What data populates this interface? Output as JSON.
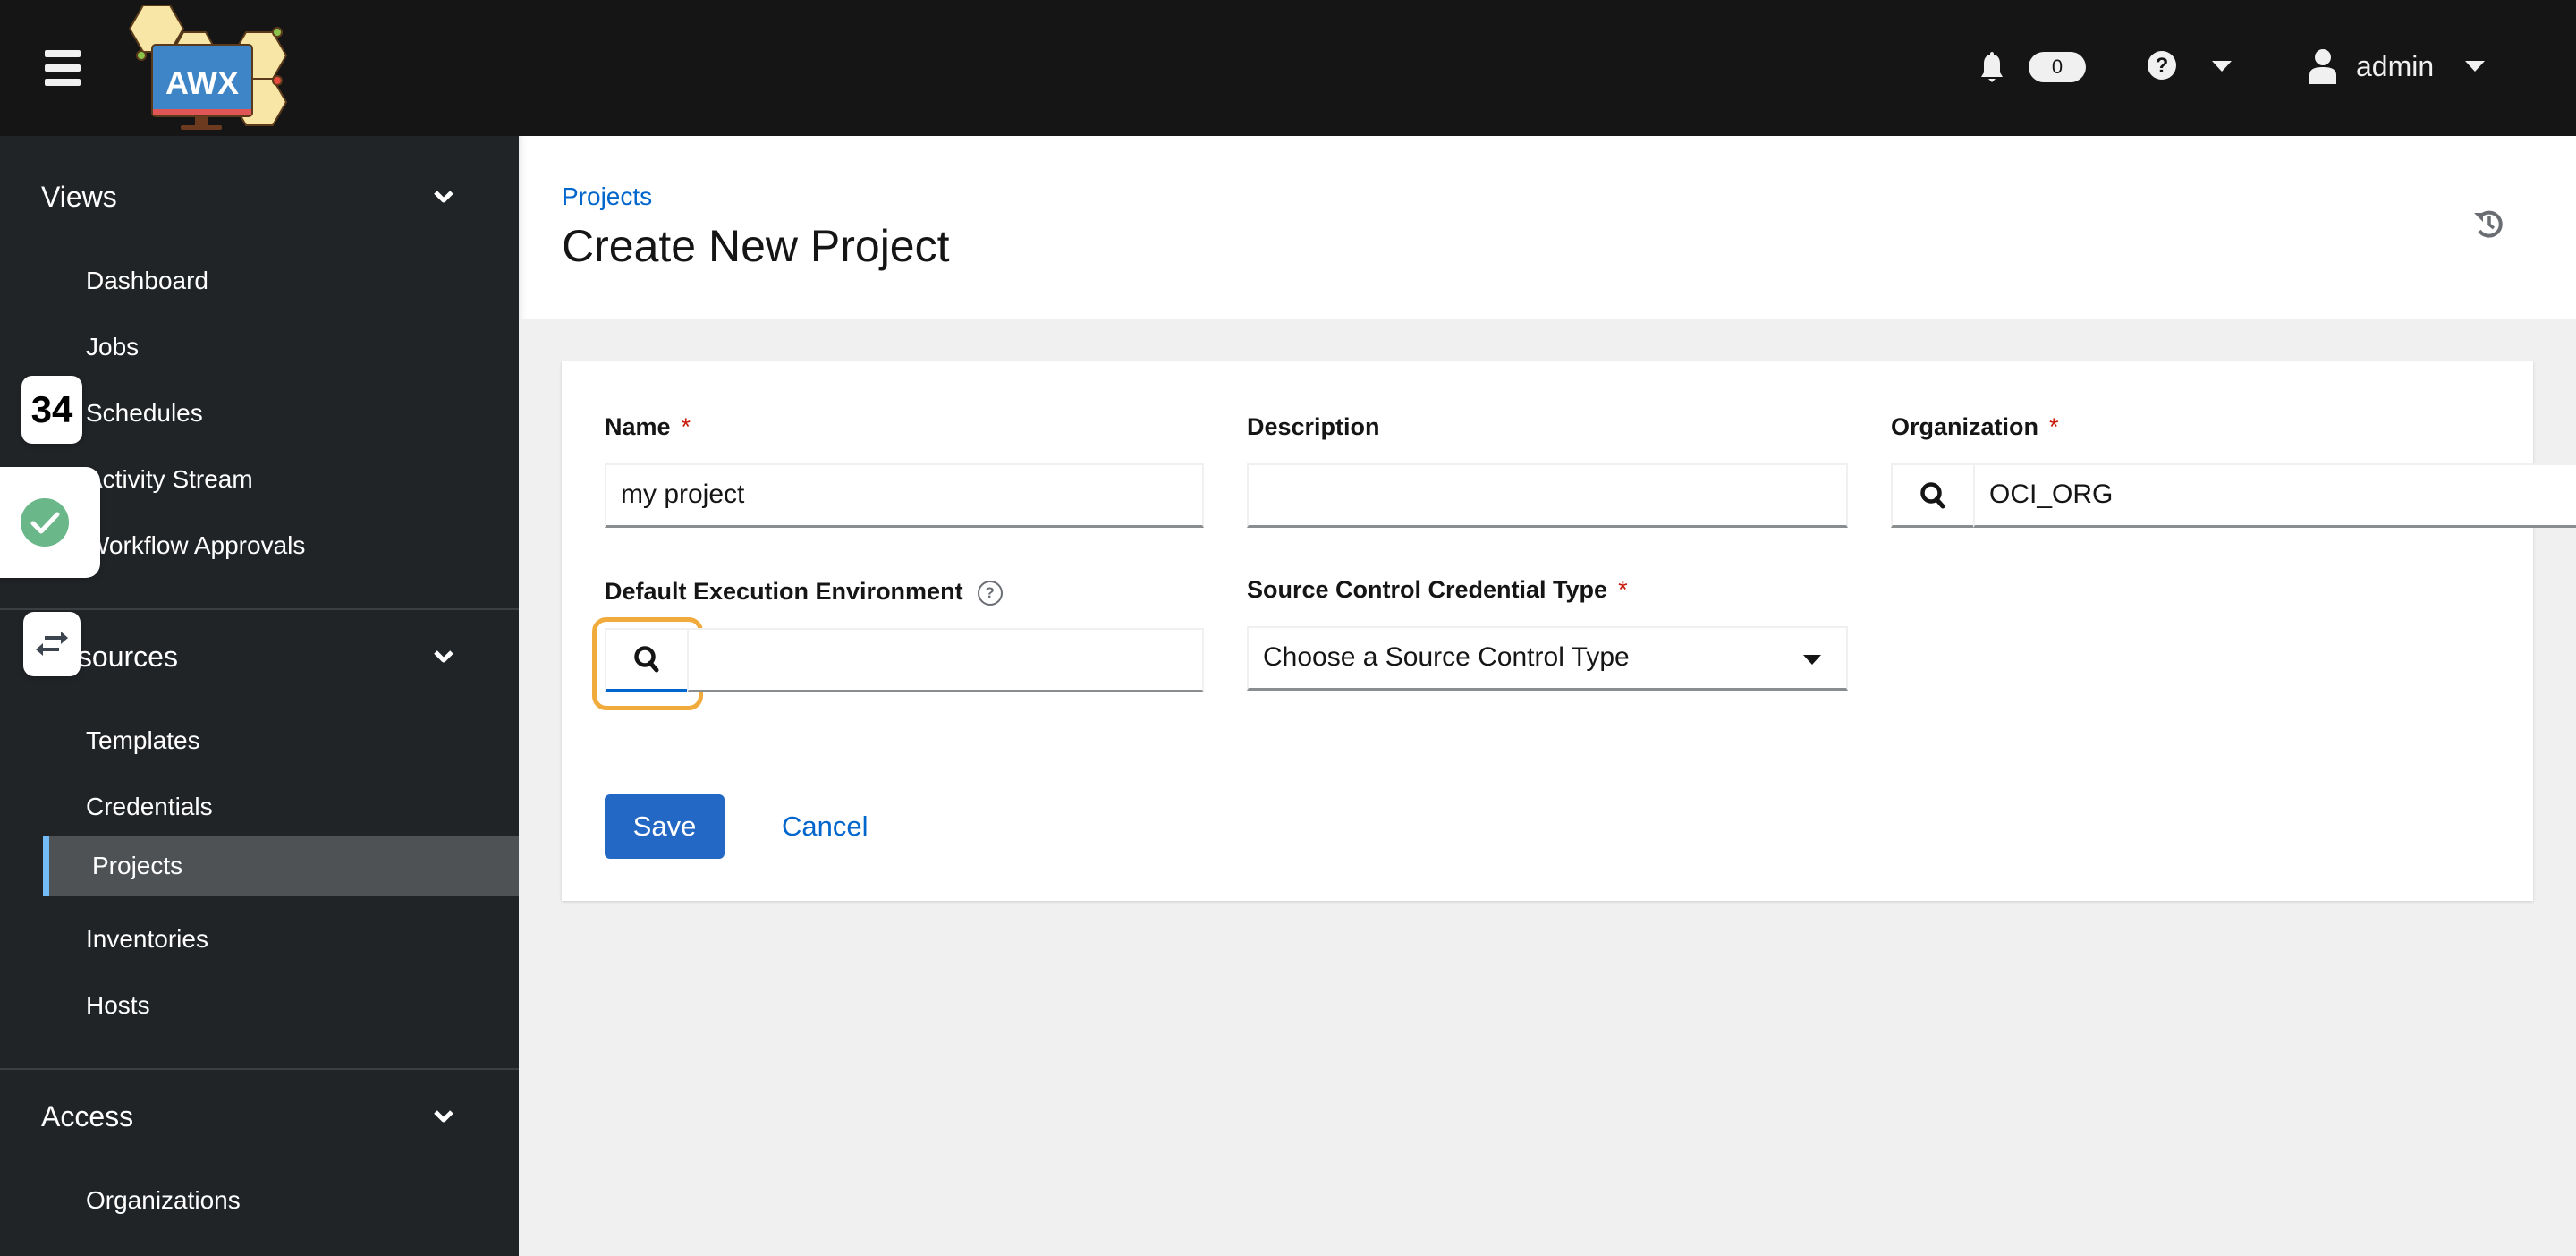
{
  "topbar": {
    "logo_text": "AWX",
    "notification_count": "0",
    "username": "admin",
    "icons": [
      "hamburger-menu-icon",
      "bell-icon",
      "question-circle-icon",
      "caret-down-icon",
      "user-icon",
      "caret-down-icon"
    ]
  },
  "sidebar": {
    "groups": [
      {
        "label": "Views",
        "items": [
          "Dashboard",
          "Jobs",
          "Schedules",
          "Activity Stream",
          "Workflow Approvals"
        ]
      },
      {
        "label": "Resources",
        "items": [
          "Templates",
          "Credentials",
          "Projects",
          "Inventories",
          "Hosts"
        ]
      },
      {
        "label": "Access",
        "items": [
          "Organizations"
        ]
      }
    ],
    "active_item": "Projects"
  },
  "overlays": {
    "counter_badge": "34",
    "check_badge_color": "#6ab78a"
  },
  "page": {
    "breadcrumb": "Projects",
    "title": "Create New Project"
  },
  "form": {
    "name": {
      "label": "Name",
      "required": "*",
      "value": "my project"
    },
    "description": {
      "label": "Description",
      "value": ""
    },
    "organization": {
      "label": "Organization",
      "required": "*",
      "value": "OCI_ORG"
    },
    "execution_environment": {
      "label": "Default Execution Environment",
      "help": "?",
      "value": ""
    },
    "scm_type": {
      "label": "Source Control Credential Type",
      "required": "*",
      "selected": "Choose a Source Control Type"
    },
    "save_label": "Save",
    "cancel_label": "Cancel"
  },
  "colors": {
    "primary": "#0066cc",
    "required": "#c9190b",
    "focus_ring": "#f0ab3c",
    "sidebar_bg": "#212427",
    "topbar_bg": "#151515",
    "active_indicator": "#73bcf7"
  }
}
